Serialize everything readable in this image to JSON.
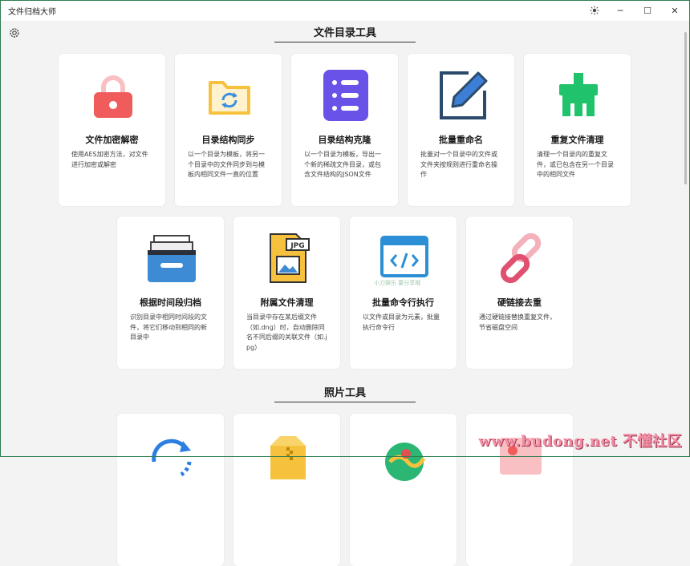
{
  "app": {
    "title": "文件归档大师"
  },
  "window": {
    "theme_icon": "sun-icon",
    "minimize": "─",
    "maximize": "☐",
    "close": "✕"
  },
  "sections": [
    {
      "title": "文件目录工具"
    },
    {
      "title": "照片工具"
    }
  ],
  "cards": [
    {
      "icon": "lock-icon",
      "title": "文件加密解密",
      "desc": "使用AES加密方法，对文件进行加密或解密"
    },
    {
      "icon": "folder-sync-icon",
      "title": "目录结构同步",
      "desc": "以一个目录为模板，将另一个目录中的文件同步到与模板内相同文件一直的位置"
    },
    {
      "icon": "list-icon",
      "title": "目录结构克隆",
      "desc": "以一个目录为模板，导出一个新的稀疏文件目录，或包含文件结构的JSON文件"
    },
    {
      "icon": "edit-icon",
      "title": "批量重命名",
      "desc": "批量对一个目录中的文件或文件夹按规则进行重命名操作"
    },
    {
      "icon": "cleanup-icon",
      "title": "重复文件清理",
      "desc": "清理一个目录内的重复文件，或已包含在另一个目录中的相同文件"
    },
    {
      "icon": "archive-box-icon",
      "title": "根据时间段归档",
      "desc": "识别目录中相同时间段的文件，将它们移动到相同的新目录中"
    },
    {
      "icon": "jpg-file-icon",
      "title": "附属文件清理",
      "desc": "当目录中存在某后缀文件（如.dng）时，自动删除同名不同后缀的关联文件（如.jpg）"
    },
    {
      "icon": "terminal-icon",
      "title": "批量命令行执行",
      "desc": "以文件或目录为元素，批量执行命令行"
    },
    {
      "icon": "hardlink-icon",
      "title": "硬链接去重",
      "desc": "通过硬链接替换重复文件，节省磁盘空间"
    }
  ],
  "photo_cards": [
    {
      "icon": "rotate-icon"
    },
    {
      "icon": "zip-icon"
    },
    {
      "icon": "map-icon"
    },
    {
      "icon": "photo-icon"
    }
  ],
  "watermark": {
    "small": "小刀娱乐 要分享哦",
    "large": "www.budong.net 不懂社区"
  },
  "colors": {
    "accent": "#2e7d4f",
    "lock": "#f05c5c",
    "folder": "#f6c23e",
    "list": "#6952e8",
    "edit": "#2c4a6b",
    "clean": "#20c36b",
    "link": "#e05070"
  }
}
